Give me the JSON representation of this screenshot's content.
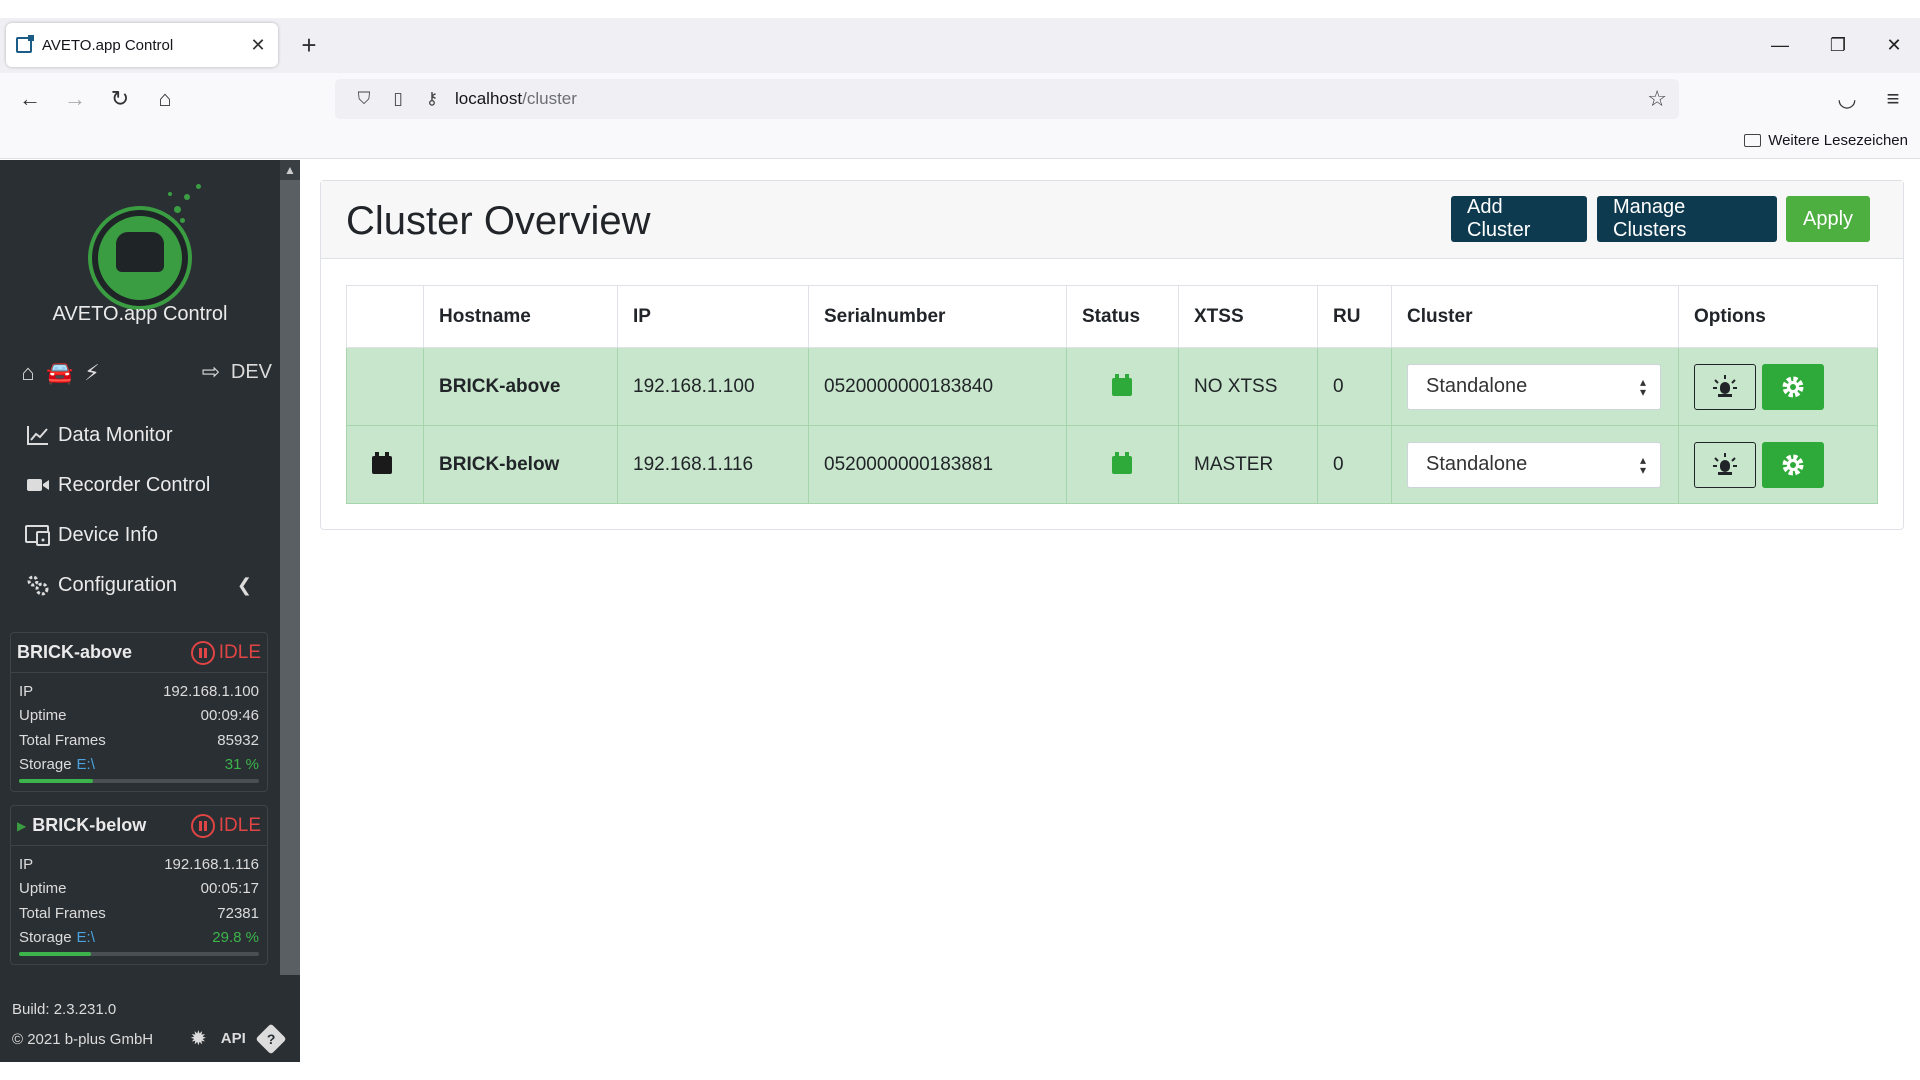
{
  "browser": {
    "tab_title": "AVETO.app Control",
    "url_host": "localhost",
    "url_path": "/cluster",
    "bookmarks_folder": "Weitere Lesezeichen"
  },
  "sidebar": {
    "app_title": "AVETO.app Control",
    "mode_label": "DEV",
    "menu": [
      {
        "label": "Data Monitor",
        "icon": "chart-line-icon"
      },
      {
        "label": "Recorder Control",
        "icon": "video-camera-icon"
      },
      {
        "label": "Device Info",
        "icon": "device-info-icon"
      },
      {
        "label": "Configuration",
        "icon": "gears-icon"
      }
    ],
    "devices": [
      {
        "name": "BRICK-above",
        "state": "IDLE",
        "ip_label": "IP",
        "ip": "192.168.1.100",
        "uptime_label": "Uptime",
        "uptime": "00:09:46",
        "frames_label": "Total Frames",
        "frames": "85932",
        "storage_label": "Storage",
        "storage_drive": "E:\\",
        "storage_pct": "31 %",
        "storage_fraction": 0.31
      },
      {
        "name": "BRICK-below",
        "state": "IDLE",
        "ip_label": "IP",
        "ip": "192.168.1.116",
        "uptime_label": "Uptime",
        "uptime": "00:05:17",
        "frames_label": "Total Frames",
        "frames": "72381",
        "storage_label": "Storage",
        "storage_drive": "E:\\",
        "storage_pct": "29.8 %",
        "storage_fraction": 0.298
      }
    ],
    "build": "Build: 2.3.231.0",
    "copyright": "© 2021 b-plus GmbH",
    "api_label": "API"
  },
  "main": {
    "title": "Cluster Overview",
    "buttons": {
      "add": "Add Cluster",
      "manage": "Manage Clusters",
      "apply": "Apply"
    },
    "columns": [
      "",
      "Hostname",
      "IP",
      "Serialnumber",
      "Status",
      "XTSS",
      "RU",
      "Cluster",
      "Options"
    ],
    "rows": [
      {
        "hostname": "BRICK-above",
        "ip": "192.168.1.100",
        "serial": "0520000000183840",
        "xtss": "NO XTSS",
        "ru": "0",
        "cluster": "Standalone"
      },
      {
        "hostname": "BRICK-below",
        "ip": "192.168.1.116",
        "serial": "0520000000183881",
        "xtss": "MASTER",
        "ru": "0",
        "cluster": "Standalone"
      }
    ]
  },
  "colors": {
    "sidebar_bg": "#2a2f33",
    "accent_green": "#4caf3f",
    "dark_button": "#0e3a4f",
    "row_green": "#c8e6cb",
    "idle_red": "#e04444"
  }
}
